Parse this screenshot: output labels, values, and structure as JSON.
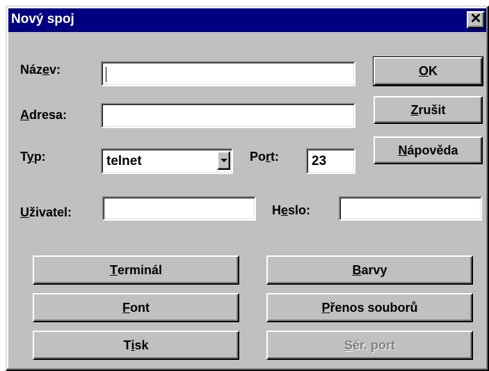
{
  "window": {
    "title": "Nový spoj",
    "close_glyph": "✕"
  },
  "fields": {
    "name": {
      "label_pre": "Náz",
      "label_key": "e",
      "label_post": "v:",
      "value": ""
    },
    "address": {
      "label_pre": "",
      "label_key": "A",
      "label_post": "dresa:",
      "value": ""
    },
    "type": {
      "label_pre": "T",
      "label_key": "y",
      "label_post": "p:",
      "value": "telnet"
    },
    "port": {
      "label_pre": "Po",
      "label_key": "r",
      "label_post": "t:",
      "value": "23"
    },
    "user": {
      "label_pre": "",
      "label_key": "U",
      "label_post": "živatel:",
      "value": ""
    },
    "password": {
      "label_pre": "H",
      "label_key": "e",
      "label_post": "slo:",
      "value": ""
    }
  },
  "buttons": {
    "ok": {
      "key": "O",
      "rest": "K"
    },
    "cancel": {
      "key": "Z",
      "rest": "rušit"
    },
    "help": {
      "key": "N",
      "rest": "ápověda"
    },
    "terminal": {
      "key": "T",
      "rest": "erminál"
    },
    "colors": {
      "key": "B",
      "rest": "arvy"
    },
    "font": {
      "key": "F",
      "rest": "ont"
    },
    "transfer": {
      "key": "P",
      "rest": "řenos souborů"
    },
    "print": {
      "pre": "T",
      "key": "i",
      "rest": "sk"
    },
    "serial": {
      "key": "S",
      "rest": "ér. port"
    }
  }
}
